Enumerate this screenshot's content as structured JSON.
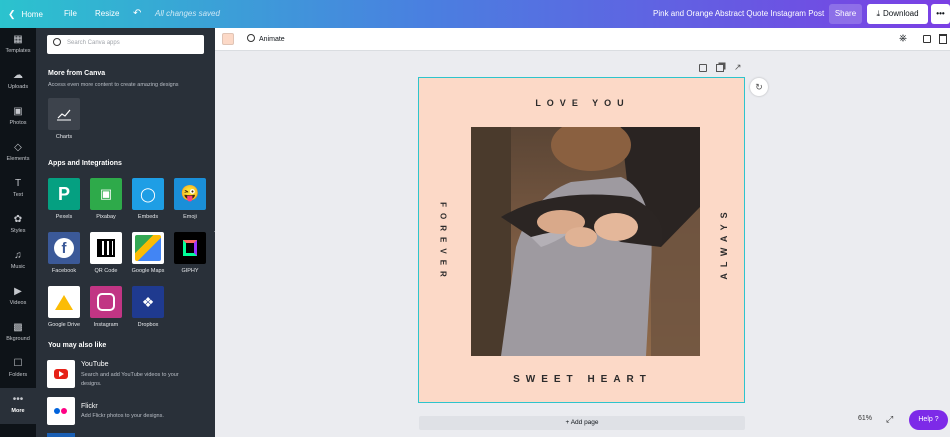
{
  "topbar": {
    "home": "Home",
    "file": "File",
    "resize": "Resize",
    "saved_status": "All changes saved",
    "doc_title": "Pink and Orange Abstract Quote Instagram Post",
    "share": "Share",
    "download": "Download"
  },
  "rail": [
    {
      "label": "Templates",
      "icon": "templates-icon"
    },
    {
      "label": "Uploads",
      "icon": "upload-icon"
    },
    {
      "label": "Photos",
      "icon": "photo-icon"
    },
    {
      "label": "Elements",
      "icon": "elements-icon"
    },
    {
      "label": "Text",
      "icon": "text-icon"
    },
    {
      "label": "Styles",
      "icon": "palette-icon"
    },
    {
      "label": "Music",
      "icon": "music-icon"
    },
    {
      "label": "Videos",
      "icon": "video-icon"
    },
    {
      "label": "Bkground",
      "icon": "background-icon"
    },
    {
      "label": "Folders",
      "icon": "folder-icon"
    },
    {
      "label": "More",
      "icon": "more-icon"
    }
  ],
  "panel": {
    "search_placeholder": "Search Canva apps",
    "more_from_canva_title": "More from Canva",
    "more_from_canva_sub": "Access even more content to create amazing designs",
    "charts": "Charts",
    "apps_title": "Apps and Integrations",
    "apps": [
      {
        "name": "Pexels",
        "color": "#05a081"
      },
      {
        "name": "Pixabay",
        "color": "#2eaa4a"
      },
      {
        "name": "Embeds",
        "color": "#1e9ee5"
      },
      {
        "name": "Emoji",
        "color": "#1a8fd8"
      },
      {
        "name": "Facebook",
        "color": "#3b5998"
      },
      {
        "name": "QR Code",
        "color": "#ffffff"
      },
      {
        "name": "Google Maps",
        "color": "#ffffff"
      },
      {
        "name": "GIPHY",
        "color": "#000000"
      },
      {
        "name": "Google Drive",
        "color": "#ffffff"
      },
      {
        "name": "Instagram",
        "color": "#c13584"
      },
      {
        "name": "Dropbox",
        "color": "#1f3a8f"
      }
    ],
    "also_like_title": "You may also like",
    "also_like": [
      {
        "name": "YouTube",
        "desc": "Search and add YouTube videos to your designs."
      },
      {
        "name": "Flickr",
        "desc": "Add Flickr photos to your designs."
      }
    ]
  },
  "toolbar": {
    "animate": "Animate",
    "swatch_color": "#fcd9c7"
  },
  "design": {
    "top": "LOVE YOU",
    "left": "FOREVER",
    "right": "ALWAYS",
    "bottom": "SWEET HEART"
  },
  "footer": {
    "add_page": "+ Add page",
    "zoom": "61%",
    "help": "Help ?"
  }
}
